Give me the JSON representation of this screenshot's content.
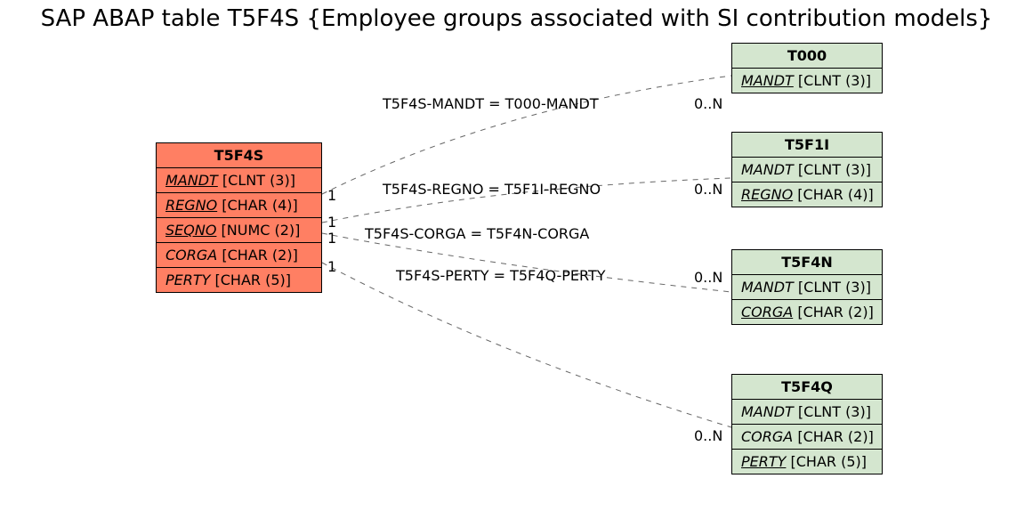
{
  "title": "SAP ABAP table T5F4S {Employee groups associated with SI contribution models}",
  "main_table": {
    "name": "T5F4S",
    "fields": [
      {
        "name": "MANDT",
        "type": "[CLNT (3)]",
        "key": true
      },
      {
        "name": "REGNO",
        "type": "[CHAR (4)]",
        "key": true
      },
      {
        "name": "SEQNO",
        "type": "[NUMC (2)]",
        "key": true
      },
      {
        "name": "CORGA",
        "type": "[CHAR (2)]",
        "fk": true
      },
      {
        "name": "PERTY",
        "type": "[CHAR (5)]",
        "fk": true
      }
    ]
  },
  "ref_tables": [
    {
      "name": "T000",
      "fields": [
        {
          "name": "MANDT",
          "type": "[CLNT (3)]",
          "key": true
        }
      ]
    },
    {
      "name": "T5F1I",
      "fields": [
        {
          "name": "MANDT",
          "type": "[CLNT (3)]",
          "fk": true
        },
        {
          "name": "REGNO",
          "type": "[CHAR (4)]",
          "key": true
        }
      ]
    },
    {
      "name": "T5F4N",
      "fields": [
        {
          "name": "MANDT",
          "type": "[CLNT (3)]",
          "fk": true
        },
        {
          "name": "CORGA",
          "type": "[CHAR (2)]",
          "key": true
        }
      ]
    },
    {
      "name": "T5F4Q",
      "fields": [
        {
          "name": "MANDT",
          "type": "[CLNT (3)]",
          "fk": true
        },
        {
          "name": "CORGA",
          "type": "[CHAR (2)]",
          "fk": true
        },
        {
          "name": "PERTY",
          "type": "[CHAR (5)]",
          "key": true
        }
      ]
    }
  ],
  "relations": [
    {
      "label": "T5F4S-MANDT = T000-MANDT",
      "left_card": "1",
      "right_card": "0..N"
    },
    {
      "label": "T5F4S-REGNO = T5F1I-REGNO",
      "left_card": "1",
      "right_card": "0..N"
    },
    {
      "label": "T5F4S-CORGA = T5F4N-CORGA",
      "left_card": "1",
      "right_card": "0..N"
    },
    {
      "label": "T5F4S-PERTY = T5F4Q-PERTY",
      "left_card": "1",
      "right_card": "0..N"
    }
  ]
}
